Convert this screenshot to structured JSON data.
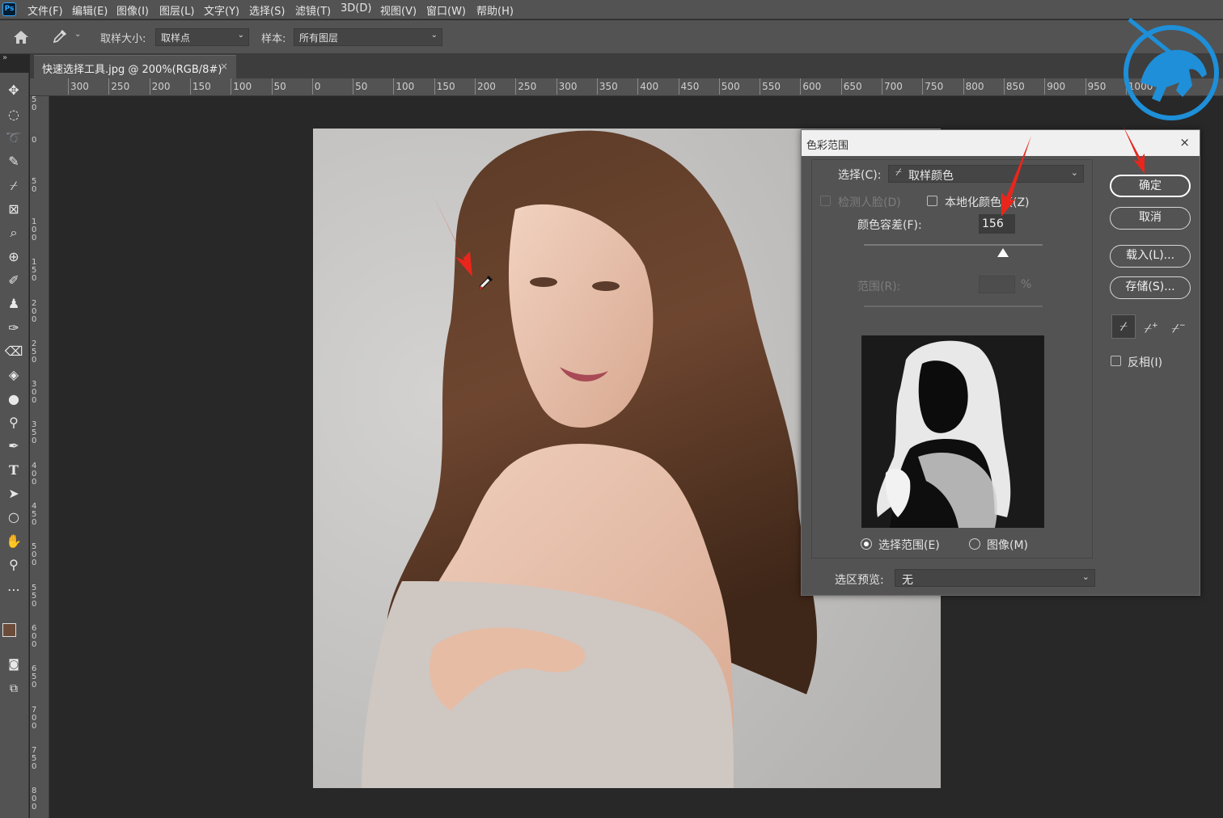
{
  "menu": {
    "app_icon": "Ps",
    "items": [
      "文件(F)",
      "编辑(E)",
      "图像(I)",
      "图层(L)",
      "文字(Y)",
      "选择(S)",
      "滤镜(T)",
      "3D(D)",
      "视图(V)",
      "窗口(W)",
      "帮助(H)"
    ]
  },
  "options": {
    "sample_size_label": "取样大小:",
    "sample_size_value": "取样点",
    "sample_label": "样本:",
    "sample_value": "所有图层"
  },
  "tab": {
    "title": "快速选择工具.jpg @ 200%(RGB/8#)",
    "close": "×"
  },
  "ruler_top": [
    "300",
    "250",
    "200",
    "150",
    "100",
    "50",
    "0",
    "50",
    "100",
    "150",
    "200",
    "250",
    "300",
    "350",
    "400",
    "450",
    "500",
    "550",
    "600",
    "650",
    "700",
    "750",
    "800",
    "850",
    "900",
    "950",
    "1000"
  ],
  "ruler_left": [
    "50",
    "0",
    "50",
    "100",
    "150",
    "200",
    "250",
    "300",
    "350",
    "400",
    "450",
    "500",
    "550",
    "600",
    "650",
    "700",
    "750",
    "800"
  ],
  "dialog": {
    "title": "色彩范围",
    "close": "×",
    "select_label": "选择(C):",
    "select_value": "取样颜色",
    "detect_faces": "检测人脸(D)",
    "localized": "本地化颜色簇(Z)",
    "fuzziness_label": "颜色容差(F):",
    "fuzziness_value": "156",
    "fuzziness_fraction": 0.78,
    "range_label": "范围(R):",
    "range_unit": "%",
    "radio_selection": "选择范围(E)",
    "radio_image": "图像(M)",
    "preview_label": "选区预览:",
    "preview_value": "无",
    "ok": "确定",
    "cancel": "取消",
    "load": "载入(L)...",
    "save": "存储(S)...",
    "invert": "反相(I)"
  },
  "colors": {
    "ui_panel": "#535353",
    "canvas_bg": "#282828",
    "annotation_arrow": "#e8261c",
    "logo_blue": "#1e8fd8"
  }
}
